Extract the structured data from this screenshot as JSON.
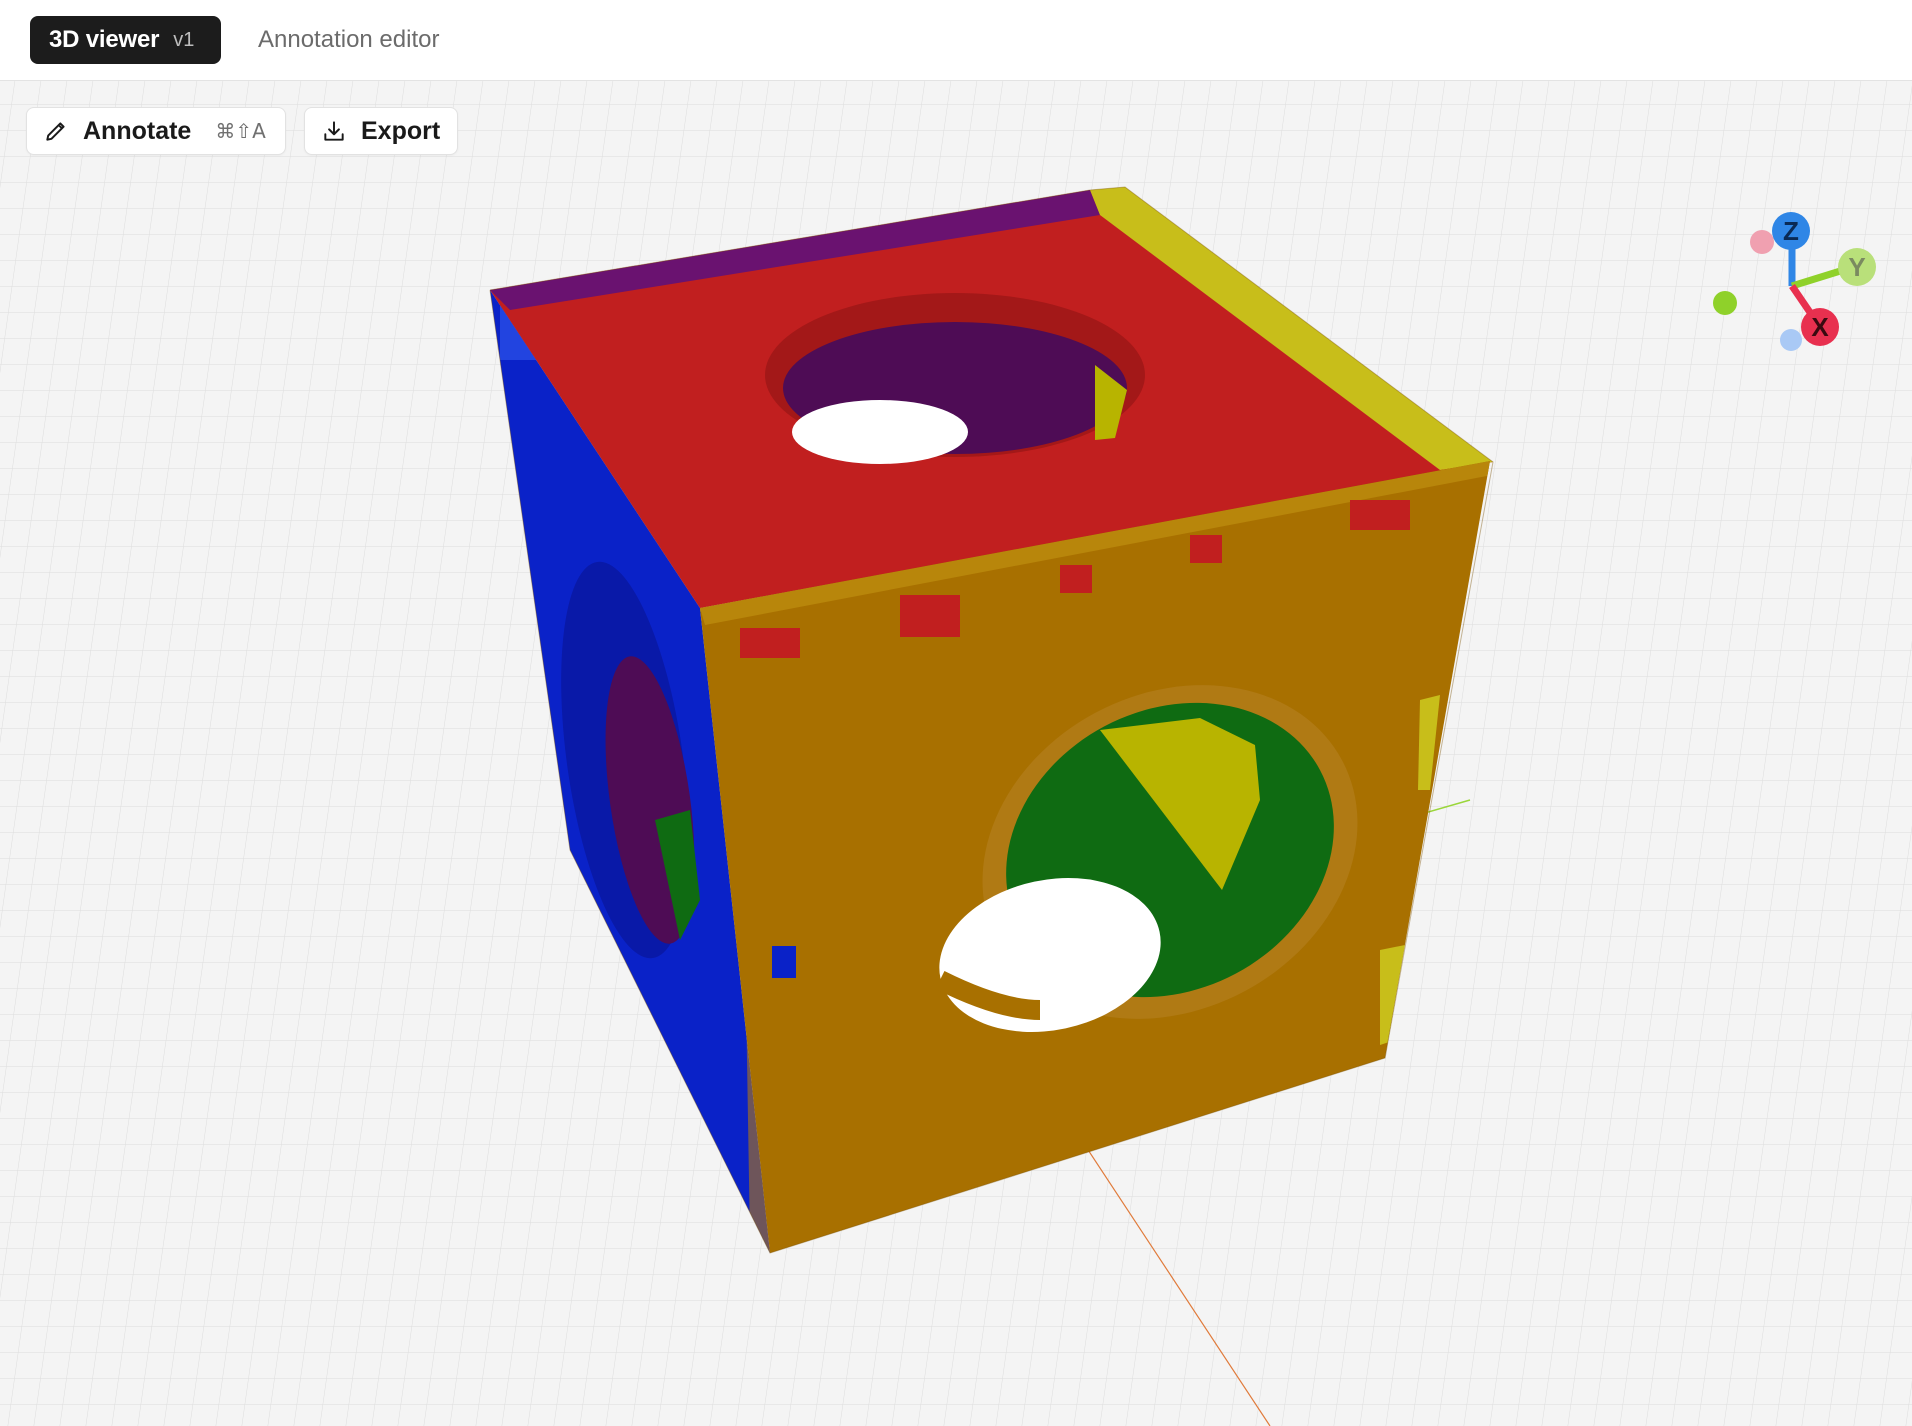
{
  "tabs": {
    "active": {
      "label": "3D viewer",
      "version": "v1"
    },
    "inactive": {
      "label": "Annotation editor"
    }
  },
  "toolbar": {
    "annotate": {
      "label": "Annotate",
      "shortcut": "⌘⇧A",
      "icon": "pencil-icon"
    },
    "export": {
      "label": "Export",
      "icon": "download-icon"
    }
  },
  "gizmo": {
    "z_label": "Z",
    "y_label": "Y",
    "x_label": "X",
    "colors": {
      "x": "#e8304f",
      "y": "#8fd12a",
      "z": "#2f86e6"
    }
  },
  "model": {
    "face_colors": {
      "top": "#c11f1f",
      "front": "#a87000",
      "left": "#0a22c8",
      "hole_inner_green": "#0f6b12",
      "hole_inner_yellow": "#b8b400",
      "hole_inner_purple": "#4e0c55"
    }
  },
  "grid": {
    "background": "#f4f4f4",
    "line_color": "#dcdcdc"
  }
}
